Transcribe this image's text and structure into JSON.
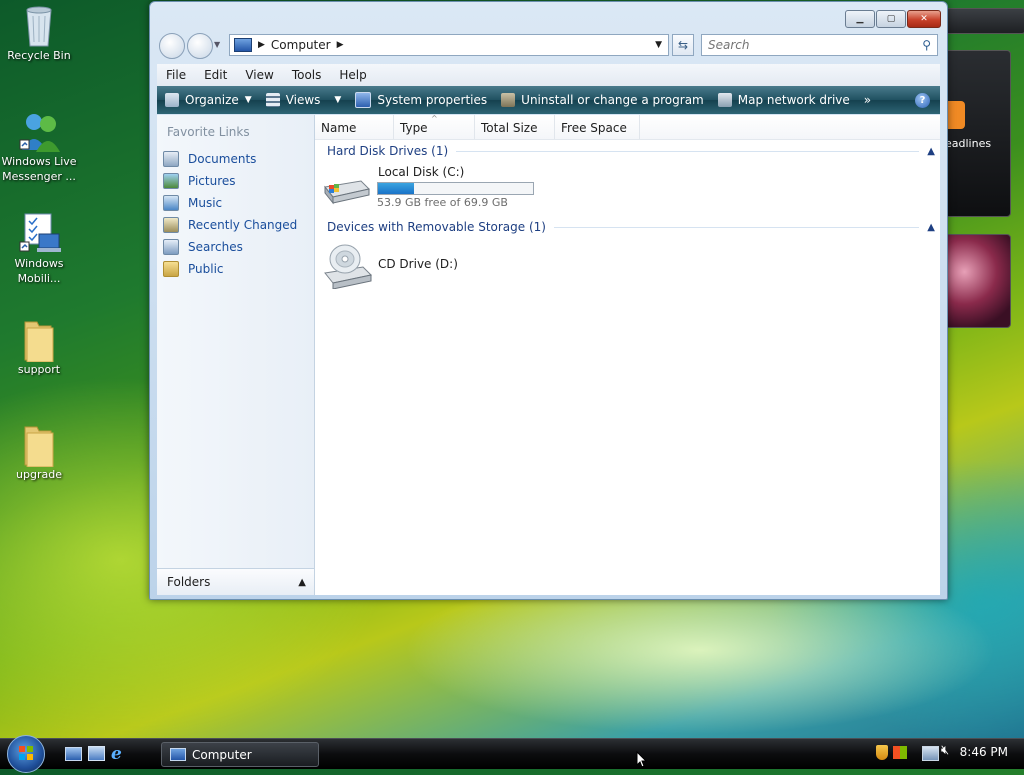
{
  "desktop": {
    "icons": [
      {
        "label": "Recycle Bin",
        "icon": "recycle-bin-icon"
      },
      {
        "label": "Windows Live Messenger ...",
        "icon": "messenger-icon"
      },
      {
        "label": "Windows Mobili...",
        "icon": "windows-mobile-icon"
      },
      {
        "label": "support",
        "icon": "folder-icon"
      },
      {
        "label": "upgrade",
        "icon": "folder-icon"
      }
    ],
    "gadget_text": "eadlines"
  },
  "window": {
    "title": "Computer",
    "address": "Computer",
    "search_placeholder": "Search",
    "menu": [
      "File",
      "Edit",
      "View",
      "Tools",
      "Help"
    ],
    "toolbar": {
      "organize": "Organize",
      "views": "Views",
      "system_properties": "System properties",
      "uninstall": "Uninstall or change a program",
      "map_drive": "Map network drive",
      "more": "»"
    },
    "favorite_links_title": "Favorite Links",
    "favorite_links": [
      "Documents",
      "Pictures",
      "Music",
      "Recently Changed",
      "Searches",
      "Public"
    ],
    "folders_label": "Folders",
    "columns": [
      "Name",
      "Type",
      "Total Size",
      "Free Space"
    ],
    "groups": {
      "hard_disks": "Hard Disk Drives (1)",
      "removable": "Devices with Removable Storage (1)"
    },
    "local_disk": {
      "label": "Local Disk (C:)",
      "free_text": "53.9 GB free of 69.9 GB",
      "used_fraction": 0.23
    },
    "cd_drive": {
      "label": "CD Drive (D:)"
    }
  },
  "taskbar": {
    "task_label": "Computer",
    "clock": "8:46 PM"
  }
}
